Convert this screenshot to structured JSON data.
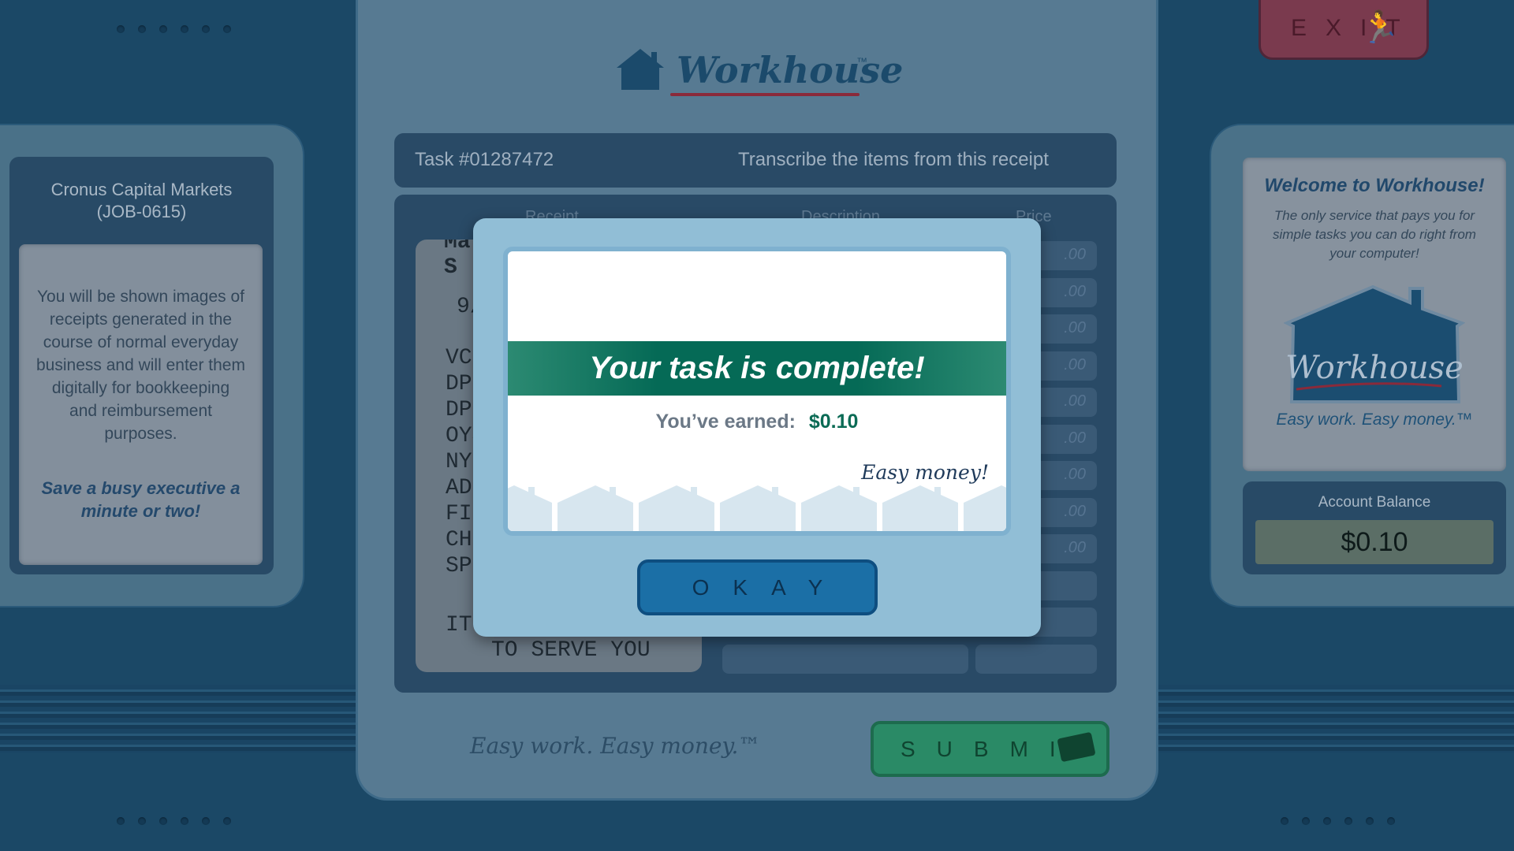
{
  "logo": {
    "text": "Workhouse",
    "tm": "™"
  },
  "exit_button": {
    "label": "EXIT",
    "icon": "running-man-with-briefcase-icon"
  },
  "job_panel": {
    "company": "Cronus Capital Markets",
    "job_id": "(JOB-0615)",
    "description": "You will be shown images of receipts generated in the course of normal everyday business and will enter them digitally for bookkeeping and reimbursement purposes.",
    "tagline": "Save a busy executive a minute or two!"
  },
  "task": {
    "number": "Task #01287472",
    "instruction": "Transcribe the items from this receipt"
  },
  "columns": {
    "receipt": "Receipt",
    "description": "Description",
    "price": "Price"
  },
  "receipt_lines": [
    "Ma",
    "S",
    "9/",
    "VC",
    "DP",
    "DP",
    "OYS",
    "NY",
    "ADI",
    "FII",
    "CHI",
    "SP",
    "IT",
    "TO SERVE YOU"
  ],
  "price_placeholder": ".00",
  "footer": {
    "tagline": "Easy work. Easy money.™",
    "submit_label": "SUBMIT",
    "submit_icon": "money-icon"
  },
  "welcome": {
    "title": "Welcome to Workhouse!",
    "body": "The only service that pays you for simple tasks you can do right from your computer!",
    "logo_text": "Workhouse",
    "slogan": "Easy work. Easy money.™"
  },
  "balance": {
    "label": "Account Balance",
    "value": "$0.10"
  },
  "modal": {
    "title": "Your task is complete!",
    "earned_label": "You’ve earned:",
    "earned_value": "$0.10",
    "easy_money": "Easy money!",
    "okay_label": "OKAY"
  },
  "colors": {
    "accent_green": "#056a56",
    "earned_green": "#0b6b55",
    "okay_blue": "#1b6fa6",
    "exit_red": "#7a3a4e"
  }
}
